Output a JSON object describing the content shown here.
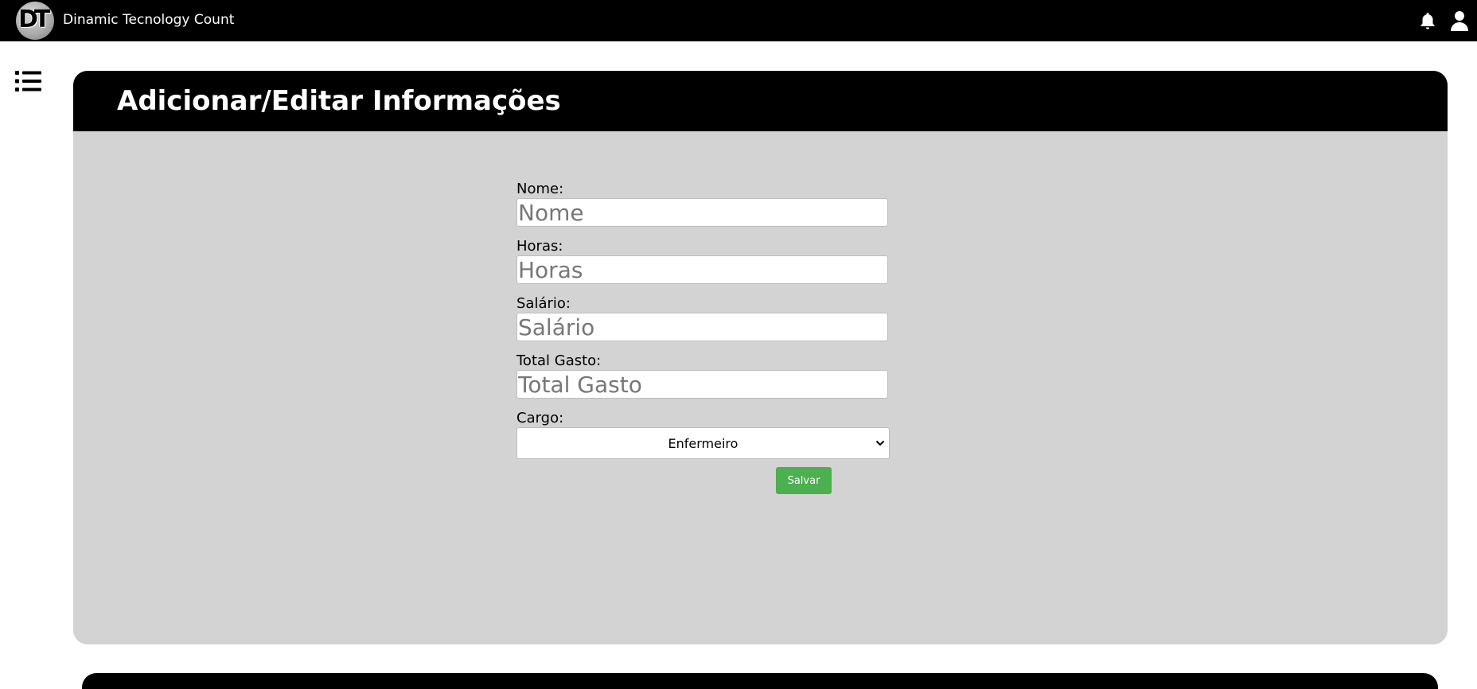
{
  "topbar": {
    "logo_text": "DT",
    "app_title": "Dinamic Tecnology Count",
    "icons": [
      "bell-icon",
      "user-icon"
    ]
  },
  "sidebar": {
    "menu_icon": "list-icon"
  },
  "card": {
    "title": "Adicionar/Editar Informações",
    "form": {
      "nome": {
        "label": "Nome:",
        "placeholder": "Nome",
        "value": ""
      },
      "horas": {
        "label": "Horas:",
        "placeholder": "Horas",
        "value": ""
      },
      "salario": {
        "label": "Salário:",
        "placeholder": "Salário",
        "value": ""
      },
      "total_gasto": {
        "label": "Total Gasto:",
        "placeholder": "Total Gasto",
        "value": ""
      },
      "cargo": {
        "label": "Cargo:",
        "selected": "Enfermeiro"
      },
      "save_label": "Salvar"
    }
  },
  "colors": {
    "topbar_bg": "#000000",
    "card_bg": "#d3d3d3",
    "card_header_bg": "#000000",
    "save_button": "#4caf50"
  }
}
